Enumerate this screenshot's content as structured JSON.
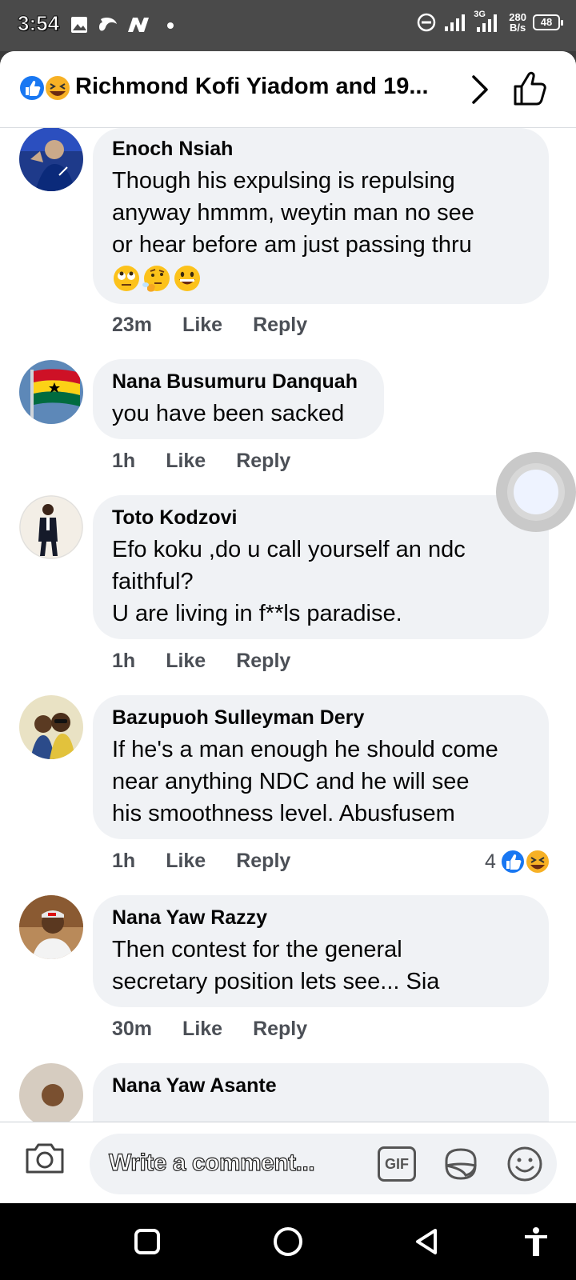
{
  "status_bar": {
    "time": "3:54",
    "network": "3G",
    "speed_value": "280",
    "speed_unit": "B/s",
    "battery": "48"
  },
  "header": {
    "title": "Richmond Kofi Yiadom and 19..."
  },
  "comments": [
    {
      "author": "Enoch Nsiah",
      "text": "Though his expulsing is repulsing\nanyway hmmm, weytin man no see\nor hear before  am just passing thru",
      "emojis": [
        "eye-roll-emoji",
        "thinking-emoji",
        "grinning-emoji"
      ],
      "time": "23m",
      "like_label": "Like",
      "reply_label": "Reply"
    },
    {
      "author": "Nana Busumuru Danquah",
      "text": "you have been sacked",
      "time": "1h",
      "like_label": "Like",
      "reply_label": "Reply"
    },
    {
      "author": "Toto Kodzovi",
      "text": "Efo koku ,do u call yourself an ndc\nfaithful?\nU are living in f**ls paradise.",
      "time": "1h",
      "like_label": "Like",
      "reply_label": "Reply"
    },
    {
      "author": "Bazupuoh Sulleyman Dery",
      "text": "If he's a man enough he should come\nnear anything NDC and he will see\nhis smoothness level. Abusfusem",
      "time": "1h",
      "like_label": "Like",
      "reply_label": "Reply",
      "reaction_count": "4"
    },
    {
      "author": "Nana Yaw Razzy",
      "text": "Then contest for the general\nsecretary position lets see... Sia",
      "time": "30m",
      "like_label": "Like",
      "reply_label": "Reply"
    },
    {
      "author": "Nana Yaw Asante"
    }
  ],
  "composer": {
    "placeholder": "Write a comment...",
    "gif_label": "GIF"
  },
  "colors": {
    "accent": "#1877f2",
    "bubble": "#f0f2f5",
    "meta_text": "#4b4f56"
  }
}
